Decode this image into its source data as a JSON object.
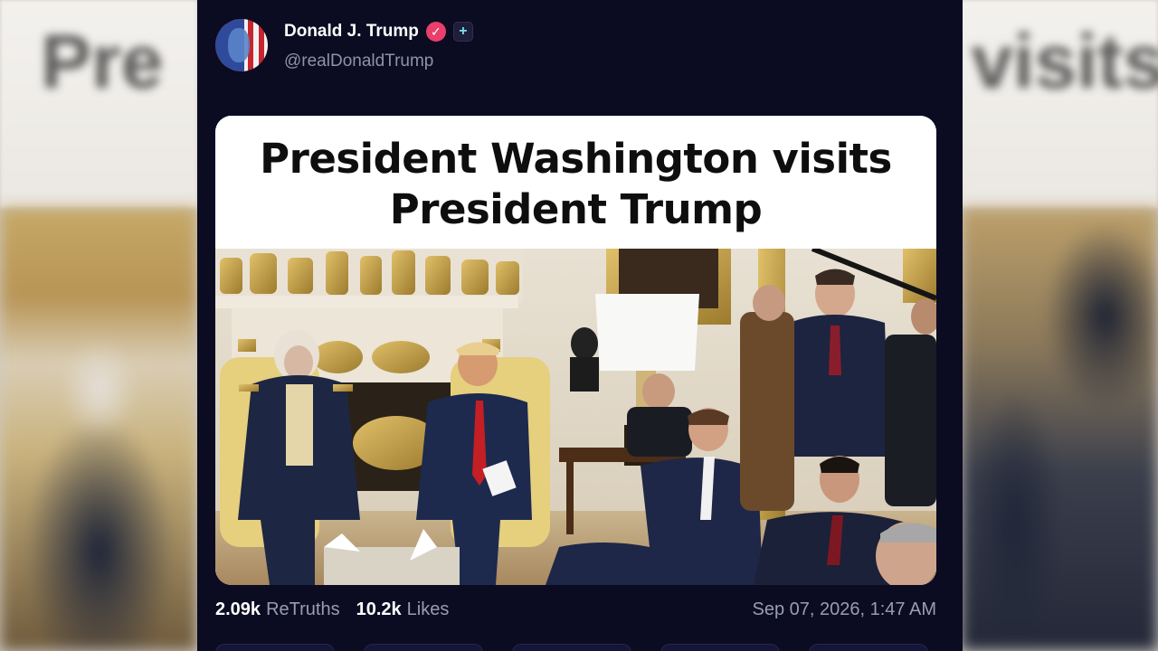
{
  "background": {
    "headline_left": "Pre",
    "headline_right": "visits"
  },
  "post": {
    "author_name": "Donald J. Trump",
    "handle": "@realDonaldTrump",
    "verified_icon": "check-badge-icon",
    "plus_icon": "plus-badge-icon",
    "media": {
      "headline_line1": "President Washington visits",
      "headline_line2": "President Trump"
    },
    "stats": {
      "retruths_count": "2.09k",
      "retruths_label": "ReTruths",
      "likes_count": "10.2k",
      "likes_label": "Likes"
    },
    "timestamp": "Sep 07, 2026, 1:47 AM"
  },
  "colors": {
    "card_background": "#0b0b22",
    "verified_badge": "#e8406a",
    "muted_text": "#9a9db0"
  }
}
